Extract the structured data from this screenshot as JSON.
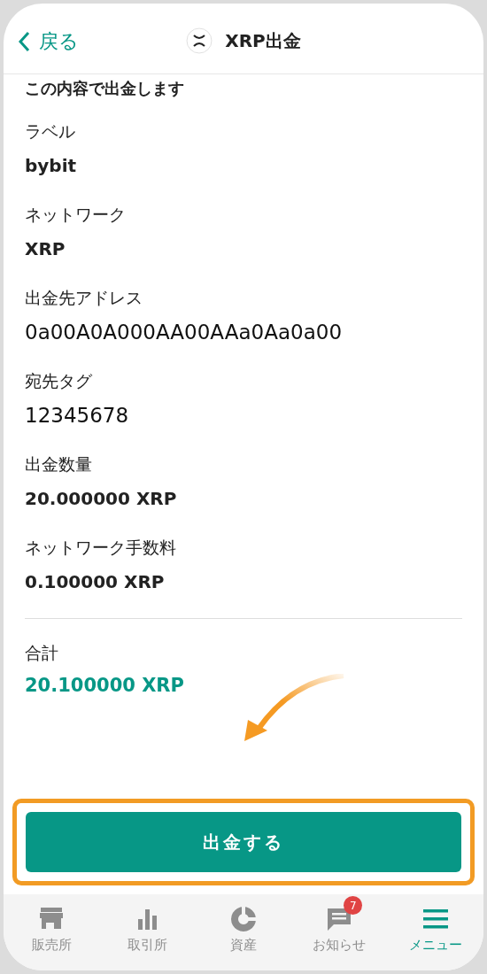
{
  "header": {
    "back": "戻る",
    "title": "XRP出金"
  },
  "intro": "この内容で出金します",
  "fields": [
    {
      "label": "ラベル",
      "value": "bybit",
      "kind": "bold"
    },
    {
      "label": "ネットワーク",
      "value": "XRP",
      "kind": "bold"
    },
    {
      "label": "出金先アドレス",
      "value": "0a00A0A000AA00AAa0Aa0a00",
      "kind": "regular"
    },
    {
      "label": "宛先タグ",
      "value": "12345678",
      "kind": "regular"
    },
    {
      "label": "出金数量",
      "value": "20.000000 XRP",
      "kind": "bold"
    },
    {
      "label": "ネットワーク手数料",
      "value": "0.100000 XRP",
      "kind": "bold"
    }
  ],
  "total": {
    "label": "合計",
    "value": "20.100000 XRP"
  },
  "submit": "出金する",
  "nav": [
    {
      "label": "販売所",
      "selected": false
    },
    {
      "label": "取引所",
      "selected": false
    },
    {
      "label": "資産",
      "selected": false
    },
    {
      "label": "お知らせ",
      "selected": false,
      "badge": "7"
    },
    {
      "label": "メニュー",
      "selected": true
    }
  ]
}
